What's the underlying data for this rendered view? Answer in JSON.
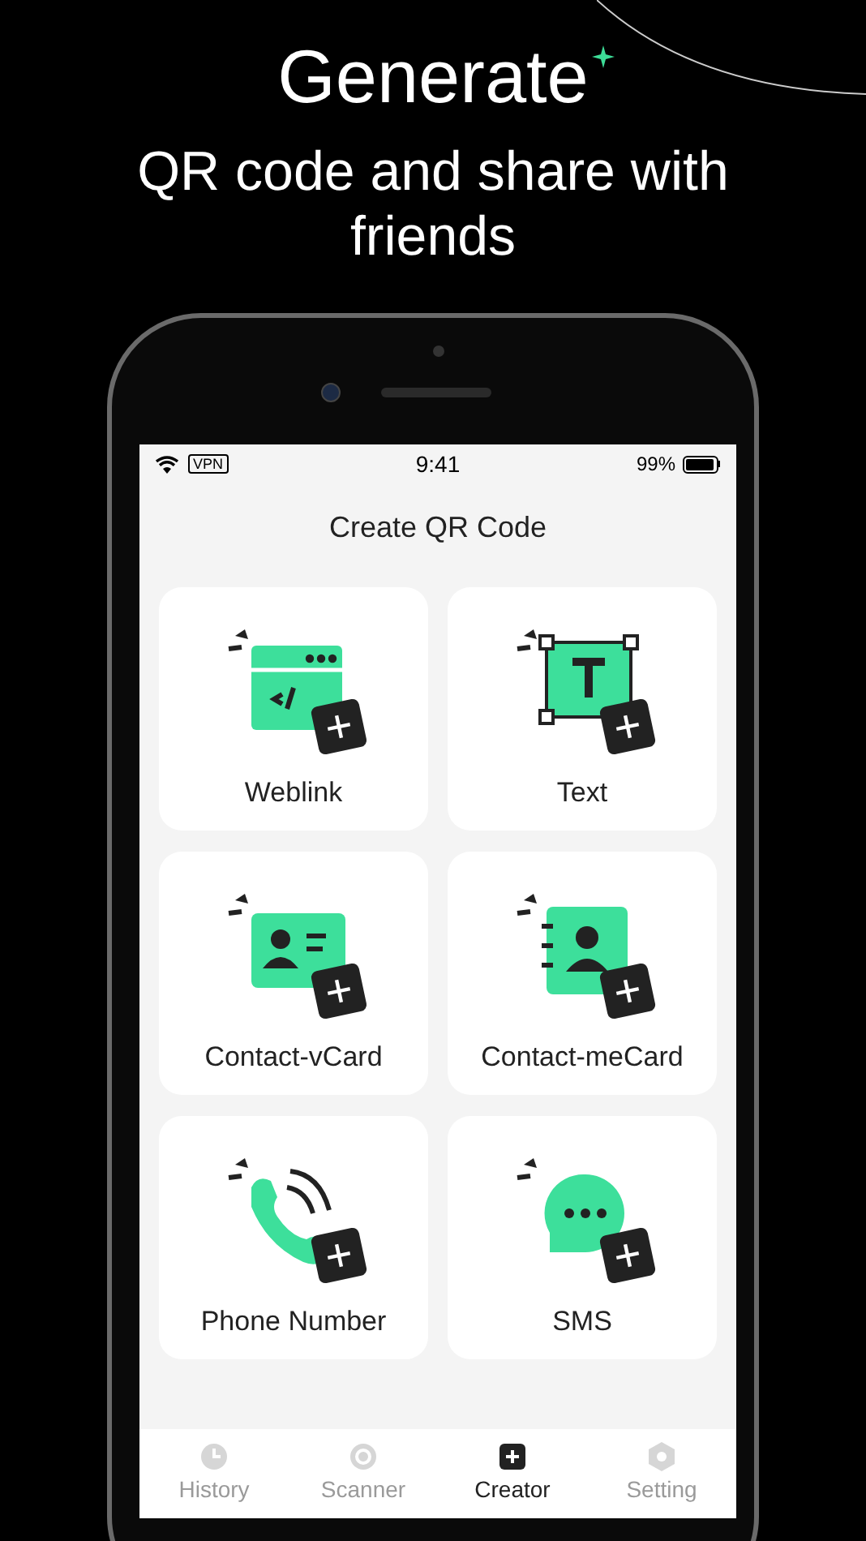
{
  "headline": "Generate",
  "subtitle": "QR code and share with friends",
  "status_bar": {
    "vpn": "VPN",
    "time": "9:41",
    "battery": "99%"
  },
  "screen_title": "Create QR Code",
  "items": [
    {
      "kind": "weblink",
      "label": "Weblink"
    },
    {
      "kind": "text",
      "label": "Text"
    },
    {
      "kind": "vcard",
      "label": "Contact-vCard"
    },
    {
      "kind": "mecard",
      "label": "Contact-meCard"
    },
    {
      "kind": "phone",
      "label": "Phone Number"
    },
    {
      "kind": "sms",
      "label": "SMS"
    }
  ],
  "tabs": [
    {
      "kind": "history",
      "label": "History",
      "selected": false
    },
    {
      "kind": "scanner",
      "label": "Scanner",
      "selected": false
    },
    {
      "kind": "creator",
      "label": "Creator",
      "selected": true
    },
    {
      "kind": "setting",
      "label": "Setting",
      "selected": false
    }
  ]
}
